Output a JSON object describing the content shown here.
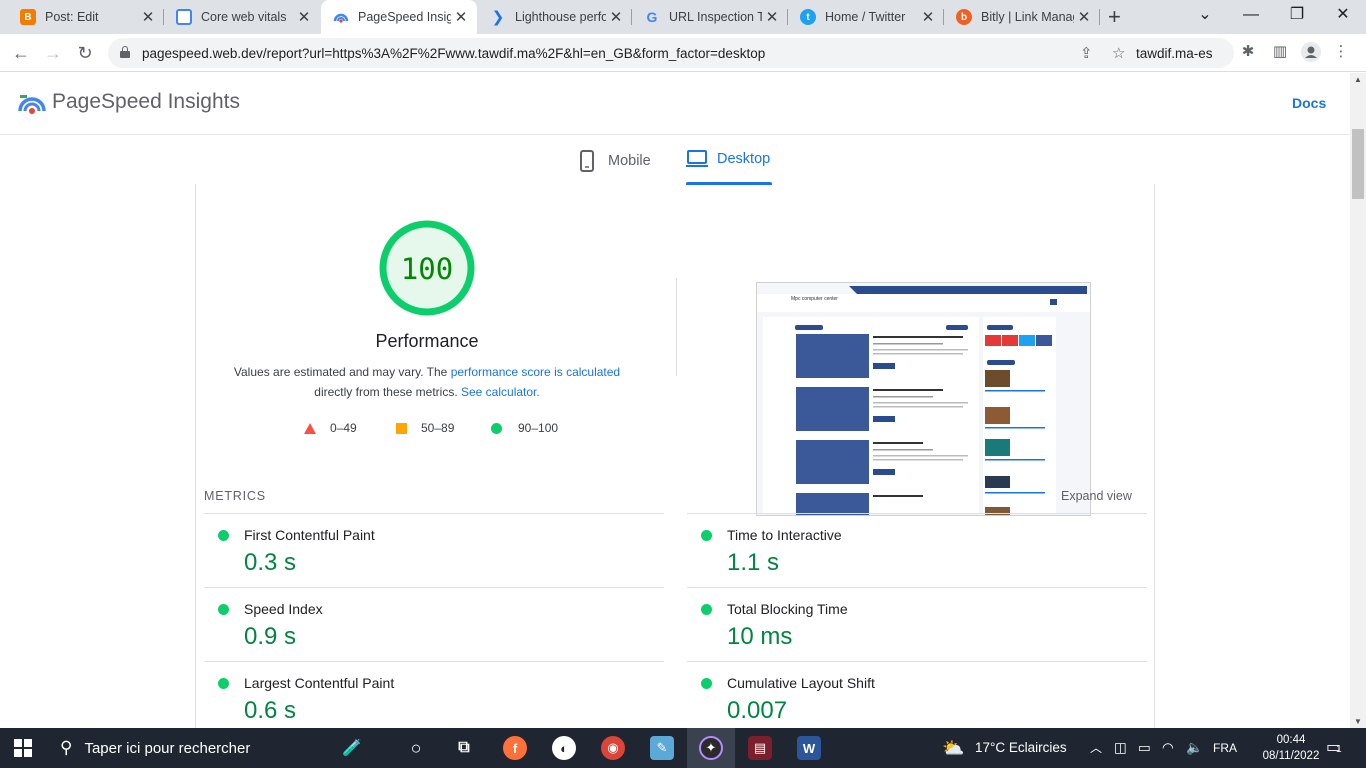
{
  "browser": {
    "tabs": [
      {
        "title": "Post: Edit",
        "icon": "blogger-icon",
        "color": "#f57c00"
      },
      {
        "title": "Core web vitals",
        "icon": "webvitals-icon",
        "color": "#4285f4"
      },
      {
        "title": "PageSpeed Insights",
        "icon": "pagespeed-icon",
        "color": "#1a73e8"
      },
      {
        "title": "Lighthouse performance",
        "icon": "lighthouse-icon",
        "color": "#1a73e8"
      },
      {
        "title": "URL Inspection Tool",
        "icon": "google-icon",
        "color": "#4285f4"
      },
      {
        "title": "Home / Twitter",
        "icon": "twitter-icon",
        "color": "#1da1f2"
      },
      {
        "title": "Bitly | Link Management",
        "icon": "bitly-icon",
        "color": "#ee6123"
      }
    ],
    "url": "pagespeed.web.dev/report?url=https%3A%2F%2Fwww.tawdif.ma%2F&hl=en_GB&form_factor=desktop",
    "profile": "tawdif.ma-es"
  },
  "header": {
    "title": "PageSpeed Insights",
    "docs": "Docs"
  },
  "device_tabs": {
    "mobile": "Mobile",
    "desktop": "Desktop"
  },
  "score": {
    "value": "100",
    "label": "Performance",
    "desc_1": "Values are estimated and may vary. The",
    "desc_link": "performance score is calculated",
    "desc_2": "directly from these metrics.",
    "desc_calc": "See calculator."
  },
  "legend": [
    {
      "range": "0–49",
      "color": "#ff4e42"
    },
    {
      "range": "50–89",
      "color": "#ffa400"
    },
    {
      "range": "90–100",
      "color": "#0cce6b"
    }
  ],
  "thumbnail": {
    "site_name": "Mpc computer center"
  },
  "metrics": {
    "label": "METRICS",
    "expand": "Expand view",
    "items": [
      {
        "name": "First Contentful Paint",
        "value": "0.3 s"
      },
      {
        "name": "Time to Interactive",
        "value": "1.1 s"
      },
      {
        "name": "Speed Index",
        "value": "0.9 s"
      },
      {
        "name": "Total Blocking Time",
        "value": "10 ms"
      },
      {
        "name": "Largest Contentful Paint",
        "value": "0.6 s"
      },
      {
        "name": "Cumulative Layout Shift",
        "value": "0.007"
      }
    ]
  },
  "taskbar": {
    "search_placeholder": "Taper ici pour rechercher",
    "weather": "17°C  Eclaircies",
    "language": "FRA",
    "time": "00:44",
    "date": "08/11/2022",
    "notifications": "1"
  }
}
